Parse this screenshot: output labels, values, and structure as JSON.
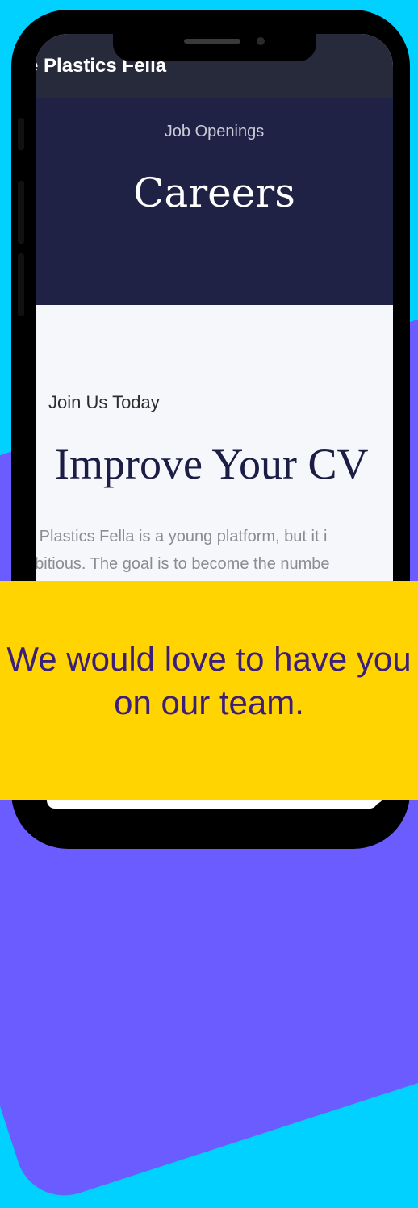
{
  "topbar": {
    "site_name": "e Plastics Fella"
  },
  "hero": {
    "kicker": "Job Openings",
    "title": "Careers"
  },
  "content": {
    "kicker": "Join Us Today",
    "title": "Improve Your CV",
    "intro_lines": [
      "e Plastics Fella is a young platform, but it i",
      "nbitious. The goal is to become the numbe"
    ]
  },
  "banner": {
    "line1": "We would love to have you",
    "line2": "on our team."
  },
  "colors": {
    "background": "#00D1FF",
    "blob": "#6A5CFF",
    "hero": "#1F2244",
    "banner": "#FFD400",
    "banner_text": "#3B1E7A"
  }
}
